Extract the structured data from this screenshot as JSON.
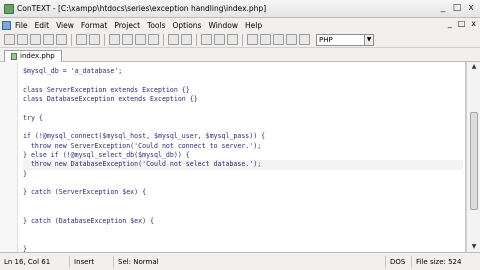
{
  "window": {
    "title": "ConTEXT - [C:\\xampp\\htdocs\\series\\exception handling\\index.php]",
    "buttons": [
      "_",
      "□",
      "x"
    ]
  },
  "menu": {
    "items": [
      "File",
      "Edit",
      "View",
      "Format",
      "Project",
      "Tools",
      "Options",
      "Window",
      "Help"
    ],
    "right": [
      "_",
      "□",
      "x"
    ]
  },
  "toolbar": {
    "language": "PHP"
  },
  "tab": {
    "label": "index.php"
  },
  "code": [
    "$mysql_db = 'a_database';",
    "",
    "class ServerException extends Exception {}",
    "class DatabaseException extends Exception {}",
    "",
    "try {",
    "",
    "if (!@mysql_connect($mysql_host, $mysql_user, $mysql_pass)) {",
    "  throw new ServerException('Could not connect to server.');",
    "} else if (!@mysql_select_db($mysql_db)) {",
    "  throw new DatabaseException('Could not select database.');",
    "}",
    "",
    "} catch (ServerException $ex) {",
    "",
    "",
    "} catch (DatabaseException $ex) {",
    "",
    "",
    "}"
  ],
  "status": {
    "position": "Ln 16, Col 61",
    "mode": "Insert",
    "selection": "Sel: Normal",
    "format": "DOS",
    "filesize": "File size: 524"
  }
}
